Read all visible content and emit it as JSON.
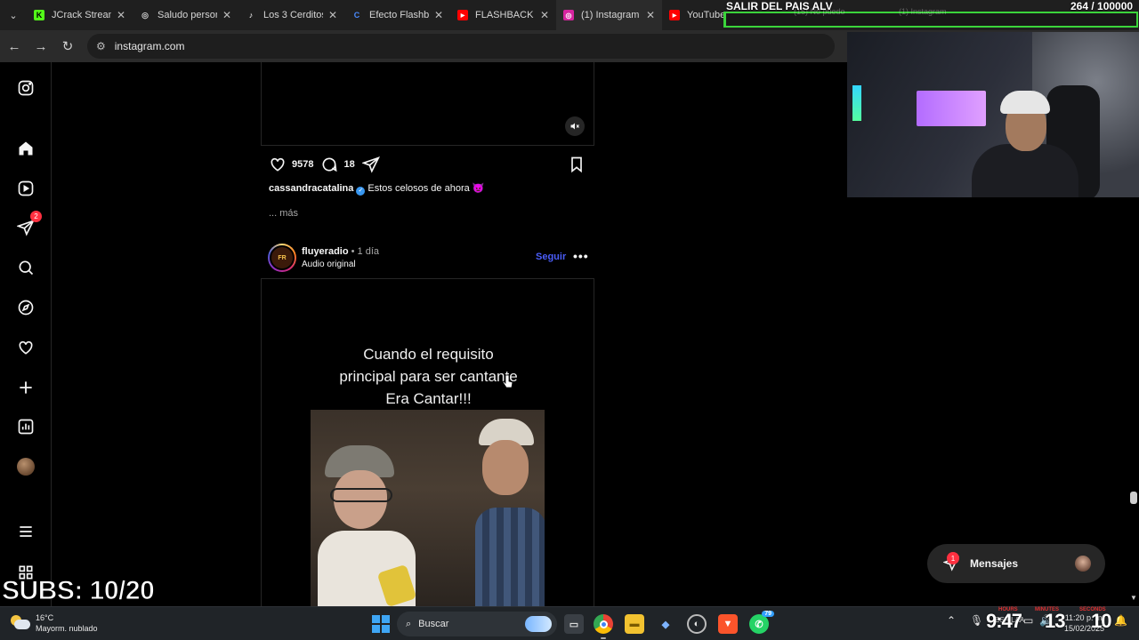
{
  "browser": {
    "tabs": [
      {
        "label": "JCrack Stream",
        "fav": "K",
        "fav_color": "#53fc18",
        "fav_text": "#000"
      },
      {
        "label": "Saludo person",
        "fav": "◎",
        "fav_color": "#1f1f1f",
        "fav_text": "#cfcfcf"
      },
      {
        "label": "Los 3 Cerditos",
        "fav": "♪",
        "fav_color": "#1f1f1f",
        "fav_text": "#ffffff"
      },
      {
        "label": "Efecto Flashba",
        "fav": "C",
        "fav_color": "#1f1f1f",
        "fav_text": "#4a8bff"
      },
      {
        "label": "FLASHBACK | T",
        "fav": "▶",
        "fav_color": "#ff0000",
        "fav_text": "#ffffff"
      },
      {
        "label": "(1) Instagram",
        "fav": "◎",
        "fav_color": "#d6249f",
        "fav_text": "#ffffff"
      },
      {
        "label": "YouTube",
        "fav": "▶",
        "fav_color": "#ff0000",
        "fav_text": "#ffffff"
      }
    ],
    "overlay_tabs": [
      "(15) No puedo",
      "(1) Instagram"
    ],
    "url": "instagram.com"
  },
  "stream_overlay": {
    "goal_title": "SALIR DEL PAIS ALV",
    "goal_count": "264  / 100000",
    "goal_progress": 0.00264,
    "goal_color": "#3bd43b",
    "subs_text": "SUBS: 10/20"
  },
  "instagram": {
    "nav_badge_notifications": "2",
    "post1": {
      "likes": "9578",
      "comments": "18",
      "caption_user": "cassandracatalina",
      "caption_text": "Estos celosos de ahora",
      "caption_emoji": "👿",
      "more": "... más"
    },
    "post2": {
      "username": "fluyeradio",
      "time": "• 1 día",
      "audio": "Audio original",
      "follow": "Seguir",
      "more_menu": "•••",
      "media_text_line1": "Cuando el requisito",
      "media_text_line2": "principal para ser cantante",
      "media_text_line3": "Era Cantar!!!"
    },
    "messages_label": "Mensajes",
    "messages_badge": "1"
  },
  "taskbar": {
    "weather_temp": "16°C",
    "weather_desc": "Mayorm. nublado",
    "search_placeholder": "Buscar",
    "whatsapp_badge": "79",
    "clock_time": "11:20 p. m.",
    "clock_date": "15/02/2025",
    "overlay_timer_1": "9:47",
    "overlay_timer_2": "13",
    "overlay_timer_3": "10",
    "overlay_labels": [
      "HOURS",
      "MINUTES",
      "SECONDS"
    ],
    "lang": "ESP LAA"
  }
}
